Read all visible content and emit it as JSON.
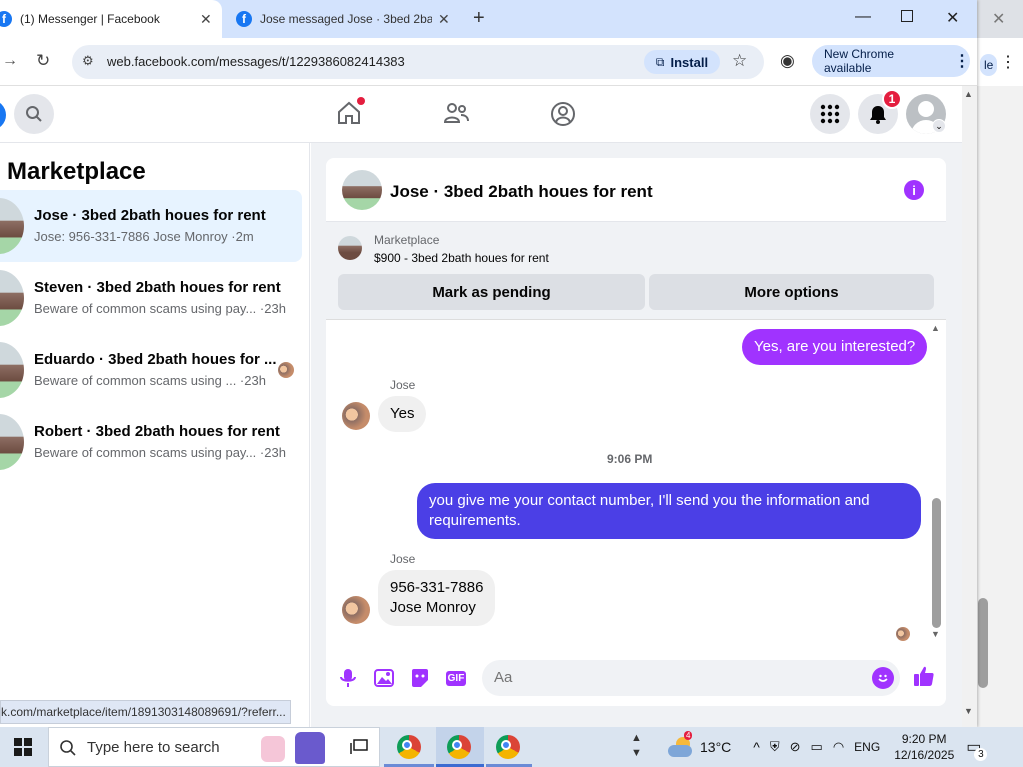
{
  "browser": {
    "tabs": [
      {
        "title": "(1) Messenger | Facebook"
      },
      {
        "title": "Jose messaged Jose · 3bed 2ba"
      }
    ],
    "url": "web.facebook.com/messages/t/1229386082414383",
    "install_label": "Install",
    "update_label": "New Chrome available",
    "status_url": "k.com/marketplace/item/1891303148089691/?referr..."
  },
  "header": {
    "notification_count": "1"
  },
  "sidebar": {
    "title": "Marketplace",
    "conversations": [
      {
        "name": "Jose · 3bed 2bath houes for rent",
        "preview": "Jose: 956-331-7886 Jose Monroy ·2m"
      },
      {
        "name": "Steven · 3bed 2bath houes for rent",
        "preview": "Beware of common scams using pay... ·23h"
      },
      {
        "name": "Eduardo · 3bed 2bath houes for ...",
        "preview": "Beware of common scams using ...  ·23h"
      },
      {
        "name": "Robert · 3bed 2bath houes for rent",
        "preview": "Beware of common scams using pay... ·23h"
      }
    ]
  },
  "chat": {
    "title": "Jose · 3bed 2bath houes for rent",
    "listing": {
      "source": "Marketplace",
      "price_title": "$900 - 3bed 2bath houes for rent",
      "pending_label": "Mark as pending",
      "options_label": "More options"
    },
    "messages": {
      "m1": "Yes, are you interested?",
      "sender1": "Jose",
      "m2": "Yes",
      "time": "9:06 PM",
      "m3": "you give me your contact number, I'll send you the information and requirements.",
      "sender2": "Jose",
      "m4a": "956-331-7886",
      "m4b": "Jose Monroy"
    },
    "composer_placeholder": "Aa"
  },
  "taskbar": {
    "search_placeholder": "Type here to search",
    "temperature": "13°C",
    "lang": "ENG",
    "time": "9:20 PM",
    "date": "12/16/2025",
    "notif_count": "3"
  },
  "colors": {
    "accent": "#a033ff",
    "outgoing_blue": "#4b3fe6",
    "fb_blue": "#1877f2"
  }
}
